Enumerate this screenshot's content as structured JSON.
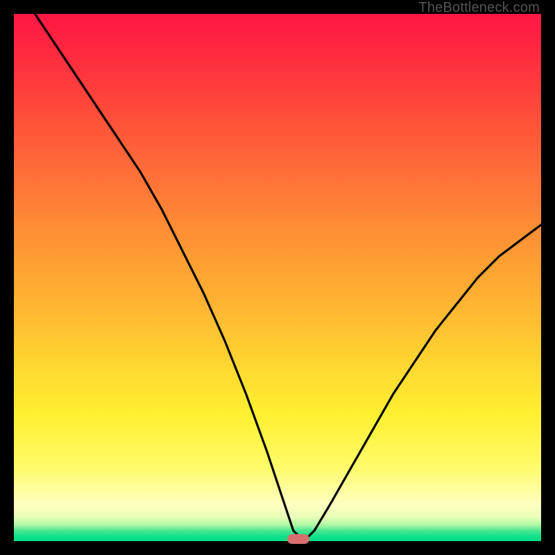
{
  "watermark": "TheBottleneck.com",
  "colors": {
    "gradient_top": "#ff1744",
    "gradient_mid": "#ffd530",
    "gradient_bottom": "#00dd88",
    "curve_stroke": "#000000",
    "marker_fill": "#d86f6f",
    "background": "#000000"
  },
  "chart_data": {
    "type": "line",
    "title": "",
    "xlabel": "",
    "ylabel": "",
    "xlim": [
      0,
      100
    ],
    "ylim": [
      0,
      100
    ],
    "grid": false,
    "legend": false,
    "annotations": [
      {
        "kind": "marker",
        "shape": "pill",
        "x": 54,
        "y": 0,
        "color": "#d86f6f"
      }
    ],
    "series": [
      {
        "name": "curve",
        "stroke": "#000000",
        "x": [
          4,
          8,
          12,
          16,
          20,
          24,
          28,
          32,
          36,
          40,
          44,
          48,
          51,
          53,
          55,
          57,
          60,
          64,
          68,
          72,
          76,
          80,
          84,
          88,
          92,
          96,
          100
        ],
        "y": [
          100,
          94,
          88,
          82,
          76,
          70,
          63,
          55,
          47,
          38,
          28,
          17,
          8,
          2,
          0,
          2,
          7,
          14,
          21,
          28,
          34,
          40,
          45,
          50,
          54,
          57,
          60
        ]
      }
    ]
  }
}
